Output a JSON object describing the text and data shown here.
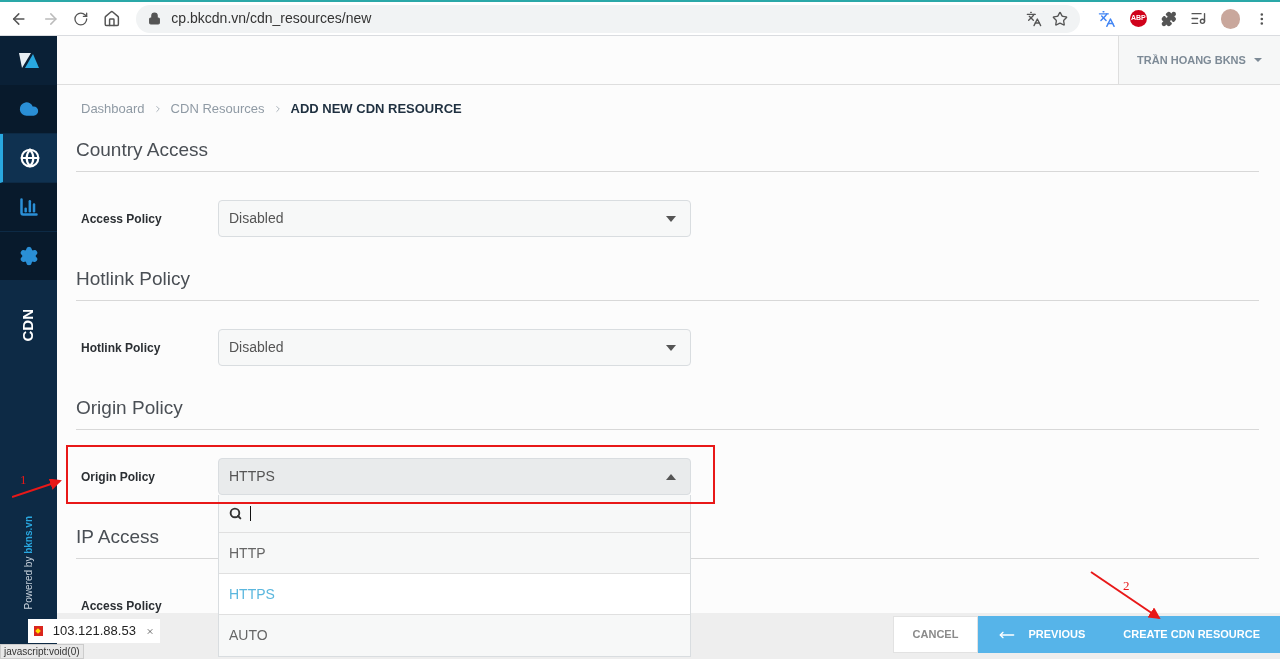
{
  "browser": {
    "url": "cp.bkcdn.vn/cdn_resources/new",
    "adblock_label": "ABP",
    "status_url": "javascript:void(0)"
  },
  "sidebar": {
    "items": [
      {
        "kind": "cloud",
        "selected": false
      },
      {
        "kind": "globe",
        "selected": true
      },
      {
        "kind": "chart",
        "selected": false
      },
      {
        "kind": "settings",
        "selected": false
      }
    ],
    "label": "CDN",
    "powered_by": "Powered by",
    "powered_link": "bkns.vn"
  },
  "user_menu": "TRẦN HOANG BKNS",
  "breadcrumb": [
    {
      "label": "Dashboard",
      "current": false
    },
    {
      "label": "CDN Resources",
      "current": false
    },
    {
      "label": "ADD NEW CDN RESOURCE",
      "current": true
    }
  ],
  "sections": [
    {
      "title": "Country Access",
      "field": {
        "label": "Access Policy",
        "value": "Disabled",
        "expanded": false
      }
    },
    {
      "title": "Hotlink Policy",
      "field": {
        "label": "Hotlink Policy",
        "value": "Disabled",
        "expanded": false
      }
    },
    {
      "title": "Origin Policy",
      "field": {
        "label": "Origin Policy",
        "value": "HTTPS",
        "expanded": true,
        "options": [
          {
            "label": "HTTP",
            "selected": false
          },
          {
            "label": "HTTPS",
            "selected": true
          },
          {
            "label": "AUTO",
            "selected": false
          }
        ]
      }
    },
    {
      "title": "IP Access",
      "field": {
        "label": "Access Policy"
      }
    }
  ],
  "footer_buttons": [
    {
      "label": "CANCEL",
      "kind": "secondary"
    },
    {
      "label": "PREVIOUS",
      "kind": "back"
    },
    {
      "label": "CREATE CDN RESOURCE",
      "kind": "primary"
    }
  ],
  "ip_tooltip": "103.121.88.53",
  "annotations": [
    {
      "label": "1"
    },
    {
      "label": "2"
    }
  ]
}
